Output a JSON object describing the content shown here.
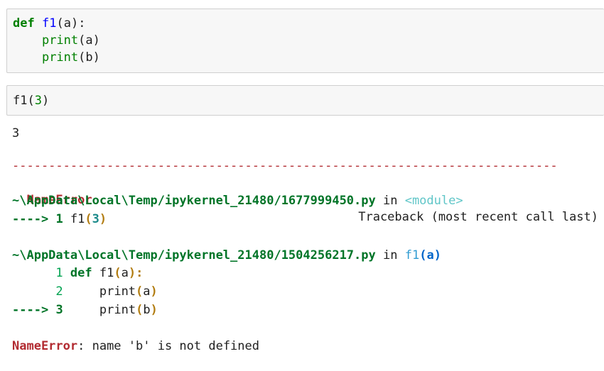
{
  "cell1": {
    "line1": {
      "kw": "def",
      "name": "f1",
      "open": "(",
      "arg": "a",
      "close": "):"
    },
    "line2": {
      "indent": "    ",
      "fn": "print",
      "args": "(a)"
    },
    "line3": {
      "indent": "    ",
      "fn": "print",
      "args": "(b)"
    }
  },
  "cell2": {
    "fn": "f1",
    "open": "(",
    "num": "3",
    "close": ")"
  },
  "output": {
    "stdout": "3",
    "dashes": "---------------------------------------------------------------------------",
    "error_name": "NameError",
    "traceback_label": "Traceback (most recent call last)",
    "frame1": {
      "path": "~\\AppData\\Local\\Temp/ipykernel_21480/1677999450.py",
      "in": " in ",
      "scope": "<module>"
    },
    "frame1_line": {
      "arrow": "---->",
      "lineno": "1",
      "code_fn": " f1",
      "open": "(",
      "num": "3",
      "close": ")"
    },
    "frame2": {
      "path": "~\\AppData\\Local\\Temp/ipykernel_21480/1504256217.py",
      "in": " in ",
      "scope_fn": "f1",
      "scope_open": "(",
      "scope_arg": "a",
      "scope_close": ")"
    },
    "frame2_l1": {
      "lineno": "1",
      "kw": "def",
      "code": " f1",
      "open": "(",
      "arg": "a",
      "close": "):"
    },
    "frame2_l2": {
      "lineno": "2",
      "code": "    print",
      "open": "(",
      "arg": "a",
      "close": ")"
    },
    "frame2_l3": {
      "arrow": "---->",
      "lineno": "3",
      "code": "    print",
      "open": "(",
      "arg": "b",
      "close": ")"
    },
    "final_error": {
      "name": "NameError",
      "message": ": name 'b' is not defined"
    }
  }
}
